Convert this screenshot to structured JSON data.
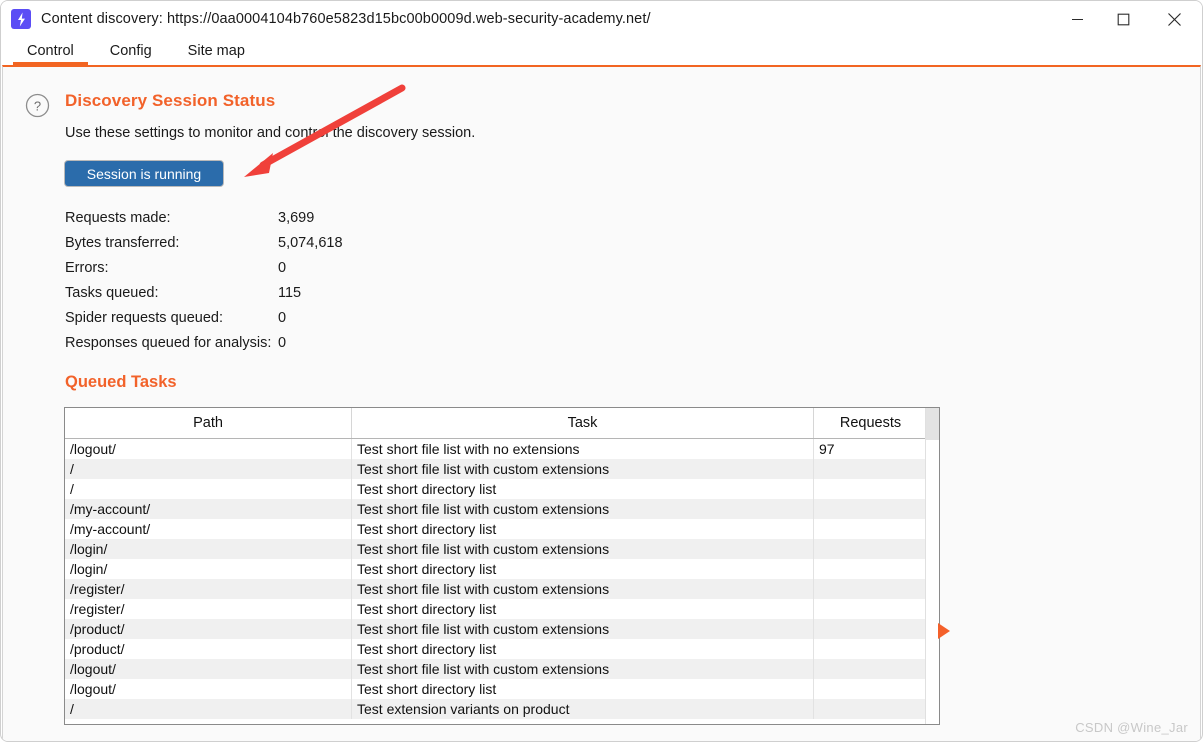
{
  "window": {
    "title": "Content discovery: https://0aa0004104b760e5823d15bc00b0009d.web-security-academy.net/",
    "app_icon": "lightning-bolt-icon",
    "controls": {
      "minimize": "minimize-icon",
      "maximize": "maximize-icon",
      "close": "close-icon"
    }
  },
  "tabs": [
    {
      "label": "Control",
      "active": true
    },
    {
      "label": "Config",
      "active": false
    },
    {
      "label": "Site map",
      "active": false
    }
  ],
  "status_section": {
    "help_icon": "question-mark-icon",
    "title": "Discovery Session Status",
    "description": "Use these settings to monitor and control the discovery session.",
    "session_button_label": "Session is running",
    "stats": [
      {
        "label": "Requests made:",
        "value": "3,699"
      },
      {
        "label": "Bytes transferred:",
        "value": "5,074,618"
      },
      {
        "label": "Errors:",
        "value": "0"
      },
      {
        "label": "Tasks queued:",
        "value": "115"
      },
      {
        "label": "Spider requests queued:",
        "value": "0"
      },
      {
        "label": "Responses queued for analysis:",
        "value": "0"
      }
    ]
  },
  "queued_tasks": {
    "title": "Queued Tasks",
    "columns": [
      "Path",
      "Task",
      "Requests"
    ],
    "rows": [
      {
        "path": "/logout/",
        "task": "Test short file list with no extensions",
        "requests": "97"
      },
      {
        "path": "/",
        "task": "Test short file list with custom extensions",
        "requests": ""
      },
      {
        "path": "/",
        "task": "Test short directory list",
        "requests": ""
      },
      {
        "path": "/my-account/",
        "task": "Test short file list with custom extensions",
        "requests": ""
      },
      {
        "path": "/my-account/",
        "task": "Test short directory list",
        "requests": ""
      },
      {
        "path": "/login/",
        "task": "Test short file list with custom extensions",
        "requests": ""
      },
      {
        "path": "/login/",
        "task": "Test short directory list",
        "requests": ""
      },
      {
        "path": "/register/",
        "task": "Test short file list with custom extensions",
        "requests": ""
      },
      {
        "path": "/register/",
        "task": "Test short directory list",
        "requests": ""
      },
      {
        "path": "/product/",
        "task": "Test short file list with custom extensions",
        "requests": ""
      },
      {
        "path": "/product/",
        "task": "Test short directory list",
        "requests": ""
      },
      {
        "path": "/logout/",
        "task": "Test short file list with custom extensions",
        "requests": ""
      },
      {
        "path": "/logout/",
        "task": "Test short directory list",
        "requests": ""
      },
      {
        "path": "/",
        "task": "Test extension variants on product",
        "requests": ""
      }
    ]
  },
  "markers": {
    "play_marker": "play-triangle-icon",
    "annotation": "red-arrow-annotation"
  },
  "watermark": "CSDN @Wine_Jar",
  "colors": {
    "accent_orange": "#f26522",
    "button_blue": "#2b6cab",
    "annotation_red": "#f0403a",
    "app_icon_purple": "#5b4df5"
  }
}
